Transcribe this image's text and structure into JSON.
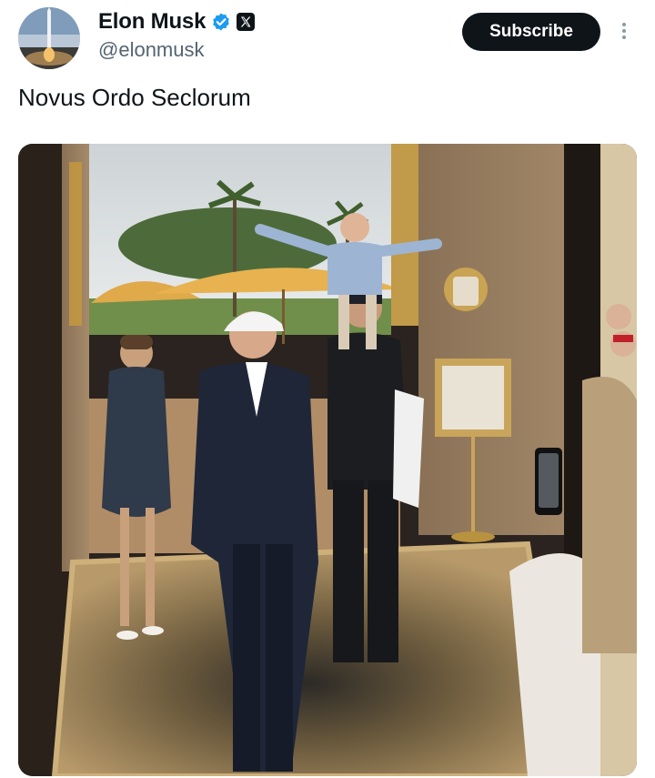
{
  "author": {
    "name": "Elon Musk",
    "handle": "@elonmusk",
    "avatar_icon": "rocket-launch-avatar",
    "verified_icon": "verified-badge-icon",
    "affiliate_icon": "x-logo-icon"
  },
  "actions": {
    "subscribe_label": "Subscribe",
    "more_icon": "more-vertical-icon"
  },
  "post": {
    "text": "Novus Ordo Seclorum",
    "media_icon": "photo"
  },
  "colors": {
    "text": "#0f1419",
    "secondary": "#536471",
    "verified": "#1d9bf0",
    "button": "#0f1419"
  }
}
